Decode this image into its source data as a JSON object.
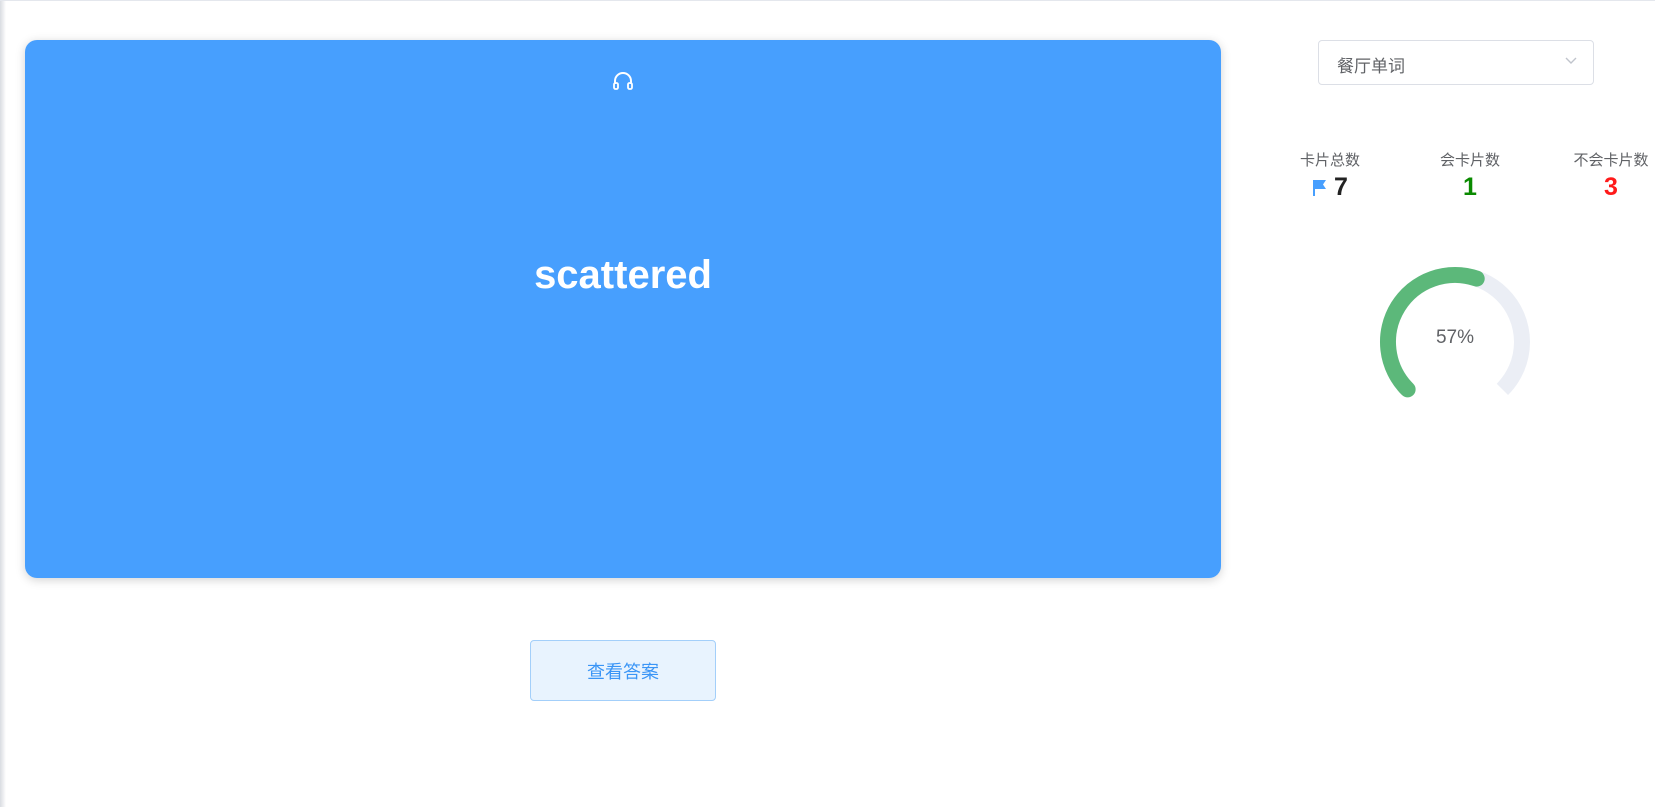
{
  "card": {
    "word": "scattered",
    "audio_icon": "headphones-icon",
    "color": "#479ffe"
  },
  "actions": {
    "show_answer_label": "查看答案"
  },
  "deck_select": {
    "selected": "餐厅单词",
    "icon": "chevron-down-icon"
  },
  "stats": {
    "total_label": "卡片总数",
    "total_value": "7",
    "total_icon": "flag-icon",
    "known_label": "会卡片数",
    "known_value": "1",
    "known_color": "#0a8a00",
    "unknown_label": "不会卡片数",
    "unknown_value": "3",
    "unknown_color": "#ff1a1a"
  },
  "progress": {
    "percent": 57,
    "label": "57%",
    "color": "#5cb87a",
    "track_color": "#ebeef5"
  }
}
